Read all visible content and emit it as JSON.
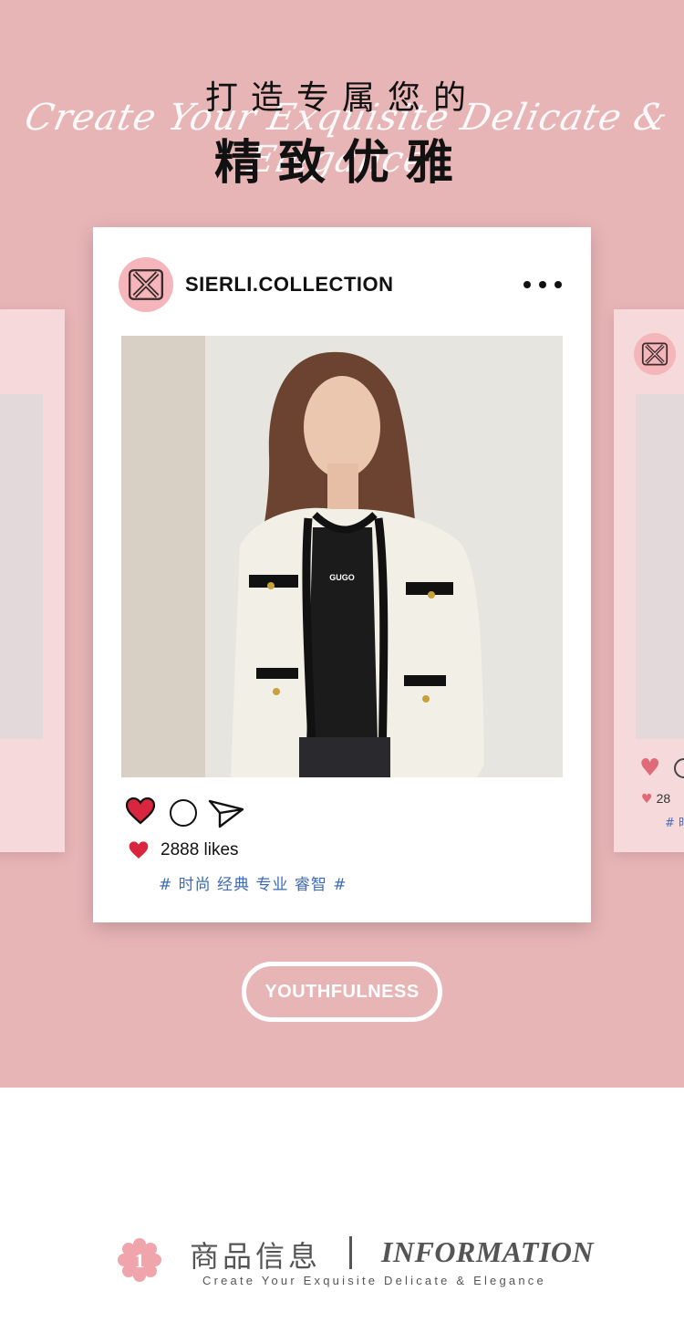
{
  "hero": {
    "title_line1": "打造专属您的",
    "title_script": "Create Your Exquisite Delicate & Elegance",
    "title_line2": "精致优雅"
  },
  "post": {
    "username": "SIERLI.COLLECTION",
    "more_icon": "more-horizontal-icon",
    "photo_print": "GUGO",
    "likes": "2888 likes",
    "tags": "# 时尚 经典 专业 睿智 #",
    "heart_color": "#d9263f"
  },
  "side_post": {
    "likes_partial": "28",
    "tags_partial": "# 时"
  },
  "pill": {
    "label": "YOUTHFULNESS"
  },
  "info": {
    "badge_number": "1",
    "title_cn": "商品信息",
    "title_en": "INFORMATION",
    "subtitle": "Create Your Exquisite Delicate & Elegance"
  },
  "colors": {
    "hero_bg": "#e8b5b7",
    "side_card_bg": "#f6d9da",
    "avatar_bg": "#f4b6bb",
    "tag_blue": "#3d6bb6"
  }
}
